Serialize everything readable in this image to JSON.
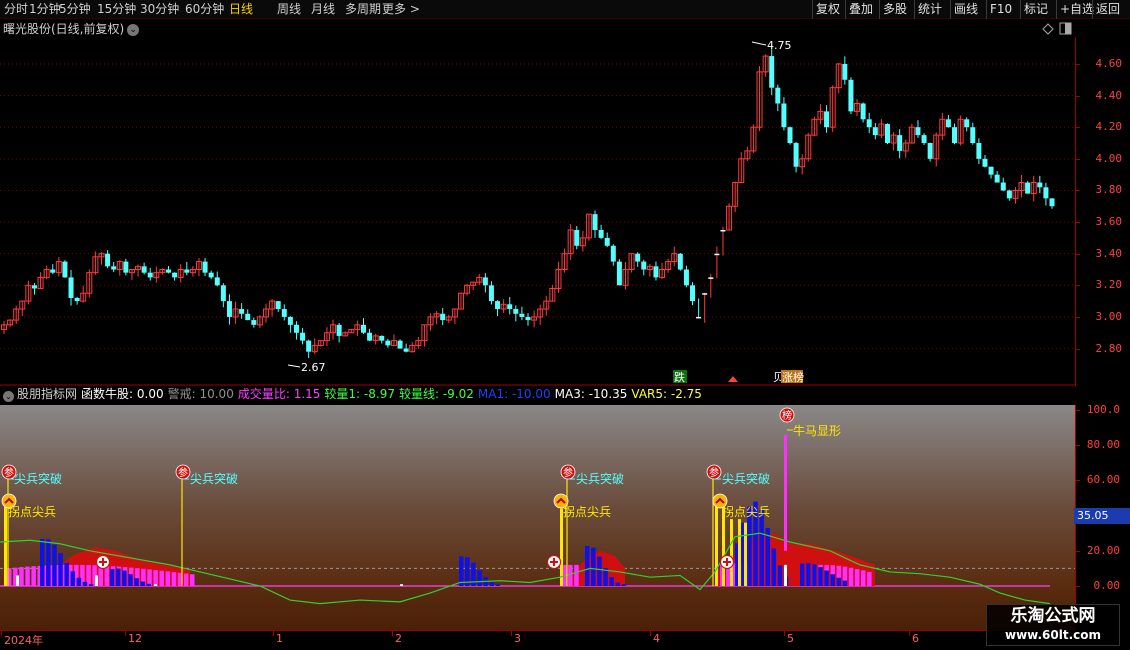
{
  "toolbar": {
    "periods": [
      "分时",
      "1分钟",
      "5分钟",
      "15分钟",
      "30分钟",
      "60分钟",
      "日线",
      "周线",
      "月线",
      "多周期",
      "更多 >"
    ],
    "active_period": "日线",
    "right_buttons": [
      "复权",
      "叠加",
      "多股",
      "统计",
      "画线",
      "F10",
      "标记",
      "+自选",
      "返回"
    ]
  },
  "main_chart": {
    "title": "曙光股份(日线,前复权)",
    "y_ticks": [
      "4.60",
      "4.40",
      "4.20",
      "4.00",
      "3.80",
      "3.60",
      "3.40",
      "3.20",
      "3.00",
      "2.80"
    ],
    "high_label": "4.75",
    "low_label": "2.67",
    "signals": [
      "跌",
      "贝",
      "涨榜"
    ]
  },
  "indicator": {
    "name": "股朋指标网",
    "fields": [
      {
        "label": "函数牛股:",
        "value": "0.00",
        "color": "#ffffff"
      },
      {
        "label": "警戒:",
        "value": "10.00",
        "color": "#909090"
      },
      {
        "label": "成交量比:",
        "value": "1.15",
        "color": "#ff40ff"
      },
      {
        "label": "较量1:",
        "value": "-8.97",
        "color": "#40ff40"
      },
      {
        "label": "较量线:",
        "value": "-9.02",
        "color": "#40ff40"
      },
      {
        "label": "MA1:",
        "value": "-10.00",
        "color": "#2040ff"
      },
      {
        "label": "MA3:",
        "value": "-10.35",
        "color": "#ffffff"
      },
      {
        "label": "VAR5:",
        "value": "-2.75",
        "color": "#ffff40"
      }
    ],
    "y_ticks": [
      "100.0",
      "80.00",
      "60.00",
      "40.00",
      "20.00",
      "0.00"
    ],
    "current_value": "35.05",
    "annotations": {
      "breakout": "尖兵突破",
      "turning": "拐点尖兵",
      "bull": "牛马显形",
      "badge_can": "参",
      "badge_bang": "榜"
    }
  },
  "x_axis": {
    "labels": [
      "2024年",
      "12",
      "1",
      "2",
      "3",
      "4",
      "5",
      "6"
    ]
  },
  "watermark": {
    "line1": "乐淘公式网",
    "line2": "www.60lt.com"
  },
  "chart_data": {
    "type": "candlestick",
    "title": "曙光股份(日线,前复权)",
    "ylim": [
      2.62,
      4.72
    ],
    "y_ticks": [
      2.8,
      3.0,
      3.2,
      3.4,
      3.6,
      3.8,
      4.0,
      4.2,
      4.4,
      4.6
    ],
    "x_labels": [
      "2024年",
      "12",
      "1",
      "2",
      "3",
      "4",
      "5",
      "6"
    ],
    "close": [
      2.95,
      2.98,
      3.05,
      3.1,
      3.2,
      3.18,
      3.25,
      3.3,
      3.28,
      3.35,
      3.25,
      3.12,
      3.1,
      3.15,
      3.28,
      3.38,
      3.4,
      3.32,
      3.3,
      3.35,
      3.28,
      3.3,
      3.32,
      3.28,
      3.25,
      3.28,
      3.3,
      3.28,
      3.25,
      3.3,
      3.28,
      3.3,
      3.35,
      3.28,
      3.25,
      3.2,
      3.1,
      3.0,
      3.05,
      3.02,
      2.98,
      2.95,
      3.0,
      3.05,
      3.1,
      3.05,
      3.0,
      2.95,
      2.9,
      2.85,
      2.78,
      2.82,
      2.85,
      2.9,
      2.95,
      2.88,
      2.9,
      2.92,
      2.95,
      2.9,
      2.85,
      2.88,
      2.85,
      2.82,
      2.85,
      2.8,
      2.78,
      2.82,
      2.85,
      2.95,
      3.0,
      3.02,
      2.98,
      3.0,
      3.05,
      3.15,
      3.2,
      3.22,
      3.25,
      3.2,
      3.1,
      3.05,
      3.08,
      3.05,
      3.02,
      3.0,
      2.98,
      3.0,
      3.05,
      3.1,
      3.18,
      3.3,
      3.4,
      3.55,
      3.45,
      3.5,
      3.65,
      3.55,
      3.5,
      3.45,
      3.35,
      3.2,
      3.3,
      3.4,
      3.35,
      3.3,
      3.32,
      3.25,
      3.3,
      3.35,
      3.4,
      3.3,
      3.2,
      3.1,
      3.0,
      3.15,
      3.25,
      3.4,
      3.55,
      3.7,
      3.85,
      4.0,
      4.05,
      4.2,
      4.55,
      4.65,
      4.45,
      4.35,
      4.2,
      4.1,
      3.95,
      4.0,
      4.15,
      4.25,
      4.3,
      4.2,
      4.45,
      4.6,
      4.5,
      4.3,
      4.35,
      4.25,
      4.2,
      4.15,
      4.22,
      4.1,
      4.15,
      4.05,
      4.1,
      4.2,
      4.15,
      4.1,
      4.0,
      4.15,
      4.25,
      4.2,
      4.1,
      4.25,
      4.2,
      4.1,
      4.0,
      3.95,
      3.9,
      3.85,
      3.8,
      3.75,
      3.8,
      3.85,
      3.78,
      3.85,
      3.82,
      3.75,
      3.7
    ]
  }
}
